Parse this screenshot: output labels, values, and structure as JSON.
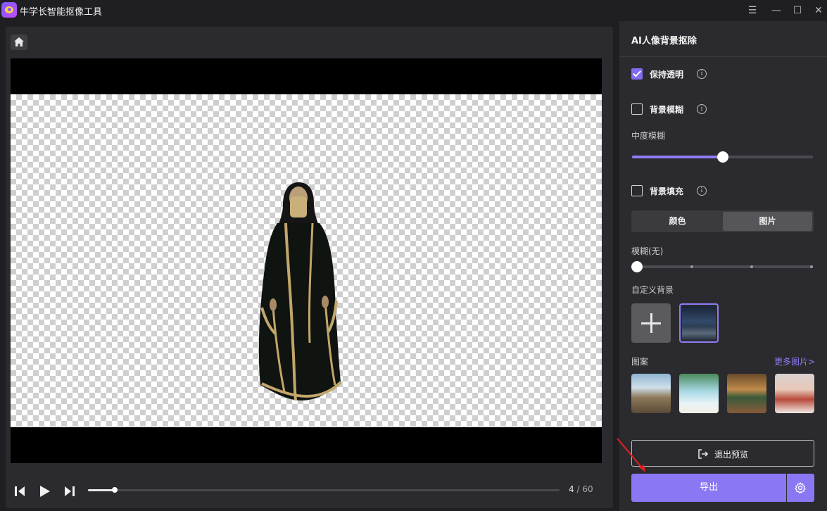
{
  "app": {
    "title": "牛学长智能抠像工具"
  },
  "window_controls": {
    "menu": "☰",
    "minimize": "—",
    "maximize": "☐",
    "close": "✕"
  },
  "player": {
    "current_frame": "4",
    "separator": " / ",
    "total_frames": "60",
    "progress": 0.056
  },
  "sidebar": {
    "title": "AI人像背景抠除",
    "keep_transparent": {
      "label": "保持透明",
      "checked": true
    },
    "bg_blur": {
      "label": "背景模糊",
      "checked": false
    },
    "blur_level": {
      "label": "中度模糊",
      "value": 0.5
    },
    "bg_fill": {
      "label": "背景填充",
      "checked": false
    },
    "fill_tabs": [
      {
        "label": "颜色",
        "active": false
      },
      {
        "label": "图片",
        "active": true
      }
    ],
    "fill_blur": {
      "label": "模糊(无)",
      "value": 0,
      "steps": 4
    },
    "custom_bg_label": "自定义背景",
    "patterns_label": "图案",
    "more_pictures": "更多图片>",
    "exit_preview": "退出预览",
    "export": "导出"
  },
  "colors": {
    "accent": "#8a77f3",
    "panel": "#2b2b2f",
    "background": "#1f1f23"
  }
}
